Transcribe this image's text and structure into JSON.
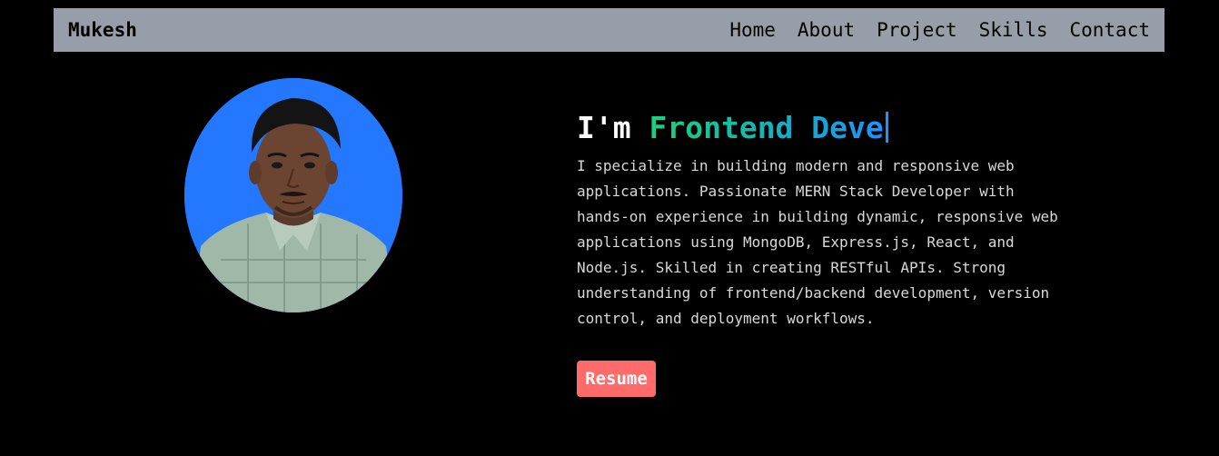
{
  "navbar": {
    "brand": "Mukesh",
    "links": [
      {
        "label": "Home"
      },
      {
        "label": "About"
      },
      {
        "label": "Project"
      },
      {
        "label": "Skills"
      },
      {
        "label": "Contact"
      }
    ],
    "background_color": "#979ea9"
  },
  "hero": {
    "avatar_background_color": "#2378ff",
    "headline_prefix": "I'm ",
    "headline_role": "Frontend Deve",
    "description": "I specialize in building modern and responsive web applications. Passionate MERN Stack Developer with hands-on experience in building dynamic, responsive web applications using MongoDB, Express.js, React, and Node.js. Skilled in creating RESTful APIs. Strong understanding of frontend/backend development, version control, and deployment workflows.",
    "resume_label": "Resume",
    "resume_color": "#ff6b6b"
  }
}
